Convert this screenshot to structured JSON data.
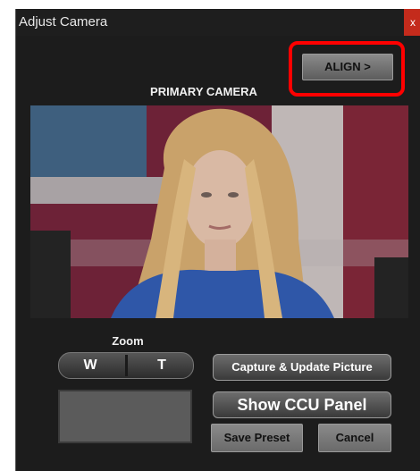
{
  "window": {
    "title": "Adjust Camera",
    "close_glyph": "x"
  },
  "header": {
    "align_label": "ALIGN >",
    "primary_label": "PRIMARY CAMERA"
  },
  "zoom": {
    "label": "Zoom",
    "wide_label": "W",
    "tele_label": "T"
  },
  "buttons": {
    "capture_label": "Capture & Update Picture",
    "ccu_label": "Show CCU Panel",
    "save_label": "Save Preset",
    "cancel_label": "Cancel"
  },
  "colors": {
    "highlight": "#ff0000",
    "close": "#c42b1c"
  }
}
